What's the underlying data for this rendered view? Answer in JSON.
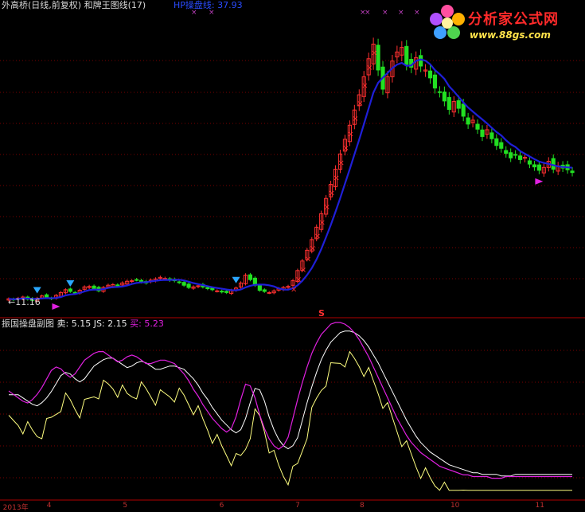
{
  "header": {
    "title": "外高桥(日线,前复权) 和牌王图线(17)",
    "ma_label": "HP操盘线: 37.93"
  },
  "price_low_label": "←11.16",
  "s_marker": "S",
  "sub": {
    "title": "振国操盘副图",
    "sell_label": "卖: 5.15",
    "js_label": "JS: 2.15",
    "buy_label": "买: 5.23"
  },
  "logo": {
    "text": "分析家公式网",
    "url": "www.88gs.com"
  },
  "axis": {
    "x_labels": [
      {
        "text": "2013年",
        "pos": 0.005
      },
      {
        "text": "4",
        "pos": 0.08
      },
      {
        "text": "5",
        "pos": 0.21
      },
      {
        "text": "6",
        "pos": 0.375
      },
      {
        "text": "7",
        "pos": 0.505
      },
      {
        "text": "8",
        "pos": 0.615
      },
      {
        "text": "10",
        "pos": 0.77
      },
      {
        "text": "11",
        "pos": 0.915
      }
    ]
  },
  "colors": {
    "up": "#ff3030",
    "down": "#22e022",
    "ma": "#1f1fd8",
    "magenta": "#e020e0",
    "white": "#ffffff",
    "yellow": "#ffff80",
    "grid": "#7a0000",
    "cyan": "#2aa8ff"
  },
  "chart_data": [
    {
      "type": "candlestick",
      "x_count": 120,
      "ylim": [
        9,
        62
      ],
      "close": [
        11.8,
        11.6,
        11.9,
        12.1,
        11.7,
        11.5,
        11.9,
        12.3,
        12.0,
        11.8,
        12.4,
        12.9,
        13.4,
        13.1,
        12.8,
        13.3,
        13.9,
        14.0,
        13.6,
        13.2,
        13.8,
        14.2,
        14.3,
        14.1,
        14.6,
        14.9,
        15.0,
        15.2,
        14.8,
        14.6,
        15.1,
        15.3,
        15.6,
        15.4,
        15.1,
        15.0,
        14.7,
        14.2,
        13.8,
        13.9,
        14.1,
        13.9,
        13.6,
        13.4,
        13.2,
        13.0,
        12.9,
        13.3,
        13.7,
        14.6,
        16.0,
        15.2,
        14.2,
        13.3,
        13.1,
        12.9,
        13.2,
        13.6,
        13.8,
        14.0,
        15.0,
        16.8,
        18.5,
        20.4,
        22.3,
        24.5,
        26.9,
        29.6,
        32.1,
        34.8,
        37.5,
        40.1,
        42.6,
        45.3,
        48.0,
        51.2,
        54.4,
        57.0,
        52.4,
        49.0,
        51.2,
        54.0,
        55.6,
        56.4,
        53.4,
        52.9,
        54.6,
        53.1,
        52.4,
        51.0,
        49.2,
        48.5,
        46.9,
        45.4,
        46.8,
        45.6,
        44.2,
        42.8,
        43.5,
        41.9,
        40.6,
        41.8,
        40.2,
        39.0,
        38.5,
        37.6,
        36.8,
        37.4,
        36.5,
        36.9,
        35.7,
        35.2,
        34.6,
        35.1,
        36.2,
        34.8,
        35.4,
        35.0,
        34.7,
        34.2
      ],
      "ma_line": true
    },
    {
      "type": "line",
      "series": [
        {
          "name": "买",
          "color": "magenta"
        },
        {
          "name": "卖",
          "color": "white"
        },
        {
          "name": "JS",
          "color": "yellow"
        }
      ],
      "x_count": 120,
      "ylim": [
        0,
        100
      ],
      "buy_values": [
        60,
        58,
        56,
        54,
        53,
        55,
        58,
        62,
        67,
        72,
        74,
        73,
        70,
        68,
        70,
        74,
        78,
        80,
        82,
        83,
        83,
        81,
        79,
        77,
        78,
        80,
        81,
        80,
        78,
        76,
        76,
        77,
        78,
        78,
        77,
        76,
        73,
        70,
        66,
        61,
        57,
        52,
        48,
        44,
        41,
        38,
        36,
        38,
        45,
        55,
        64,
        63,
        56,
        46,
        38,
        32,
        28,
        26,
        28,
        33,
        44,
        55,
        65,
        74,
        82,
        88,
        93,
        96,
        99,
        100,
        100,
        99,
        97,
        94,
        90,
        85,
        80,
        74,
        68,
        62,
        56,
        50,
        44,
        39,
        34,
        30,
        27,
        24,
        22,
        20,
        18,
        16,
        15,
        14,
        13,
        12,
        11,
        11,
        10,
        10,
        10,
        10,
        9,
        9,
        9,
        10,
        10,
        10,
        10,
        10,
        10,
        10,
        10,
        10,
        10,
        10,
        10,
        10,
        10,
        10
      ]
    }
  ]
}
